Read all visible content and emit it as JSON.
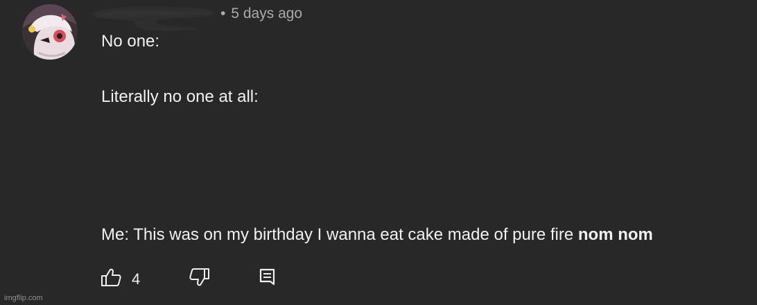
{
  "comment": {
    "timestamp_separator": "•",
    "timestamp": "5 days ago",
    "lines": {
      "line1": "No one:",
      "line2": "Literally no one at all:",
      "line3_prefix": "Me:  This was on my birthday I wanna eat cake made of pure fire ",
      "line3_bold": "nom nom"
    }
  },
  "actions": {
    "like_icon": "thumbs-up-icon",
    "like_count": "4",
    "dislike_icon": "thumbs-down-icon",
    "reply_icon": "reply-comment-icon"
  },
  "watermark": "imgflip.com",
  "colors": {
    "background": "#282828",
    "text": "#f1f1f1",
    "secondary_text": "#aaaaaa"
  }
}
